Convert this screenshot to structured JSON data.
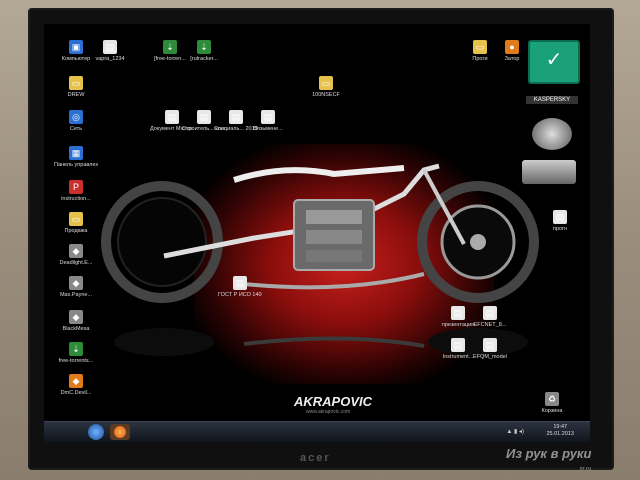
{
  "wallpaper_logo": "AKRAPOVIC",
  "wallpaper_site": "www.akrapovic.com",
  "monitor_brand": "acer",
  "watermark": "Из рук в руки",
  "watermark_site": "irr.ru",
  "desktop_icons_left": [
    {
      "label": "Компьютер",
      "icon": "computer-icon"
    },
    {
      "label": "vapra_1234",
      "icon": "document-icon"
    },
    {
      "label": "DREW",
      "icon": "folder-icon"
    },
    {
      "label": "Сеть",
      "icon": "network-icon"
    },
    {
      "label": "Панель управления",
      "icon": "control-panel-icon"
    },
    {
      "label": "instruction...",
      "icon": "pdf-icon"
    },
    {
      "label": "Продажа",
      "icon": "folder-icon"
    },
    {
      "label": "Deadlight.E...",
      "icon": "game-icon"
    },
    {
      "label": "Max.Payne...",
      "icon": "game-icon"
    },
    {
      "label": "BlackMesa",
      "icon": "game-icon"
    },
    {
      "label": "free-torrents...",
      "icon": "torrent-icon"
    },
    {
      "label": "DmC.Devil...",
      "icon": "game-icon"
    }
  ],
  "desktop_icons_top": [
    {
      "label": "[free-torren...",
      "icon": "torrent-icon"
    },
    {
      "label": "[rutracker...",
      "icon": "torrent-icon"
    },
    {
      "label": "100NSECF",
      "icon": "folder-icon"
    }
  ],
  "desktop_icons_middle": [
    {
      "label": "Документ Micros...",
      "icon": "document-icon"
    },
    {
      "label": "Строитель... колледж...",
      "icon": "document-icon"
    },
    {
      "label": "Специаль... 2013 Проект",
      "icon": "document-icon"
    },
    {
      "label": "Вязьмене...",
      "icon": "document-icon"
    },
    {
      "label": "ГОСТ Р ИСО 14001-2007",
      "icon": "document-icon"
    }
  ],
  "desktop_icons_right": [
    {
      "label": "Проги",
      "icon": "folder-icon"
    },
    {
      "label": "Затор",
      "icon": "app-icon"
    },
    {
      "label": "прогн",
      "icon": "document-icon"
    },
    {
      "label": "презентация",
      "icon": "document-icon"
    },
    {
      "label": "EFCNET_8...",
      "icon": "document-icon"
    },
    {
      "label": "Instrument...",
      "icon": "document-icon"
    },
    {
      "label": "EFQM_model",
      "icon": "document-icon"
    },
    {
      "label": "Корзина",
      "icon": "recycle-bin-icon"
    }
  ],
  "kaspersky_label": "KASPERSKY",
  "taskbar": {
    "time": "19:47",
    "date": "25.01.2013"
  },
  "colors": {
    "wallpaper_glow": "#c8201e",
    "kaspersky": "#1aa17a",
    "taskbar": "#10151c"
  }
}
